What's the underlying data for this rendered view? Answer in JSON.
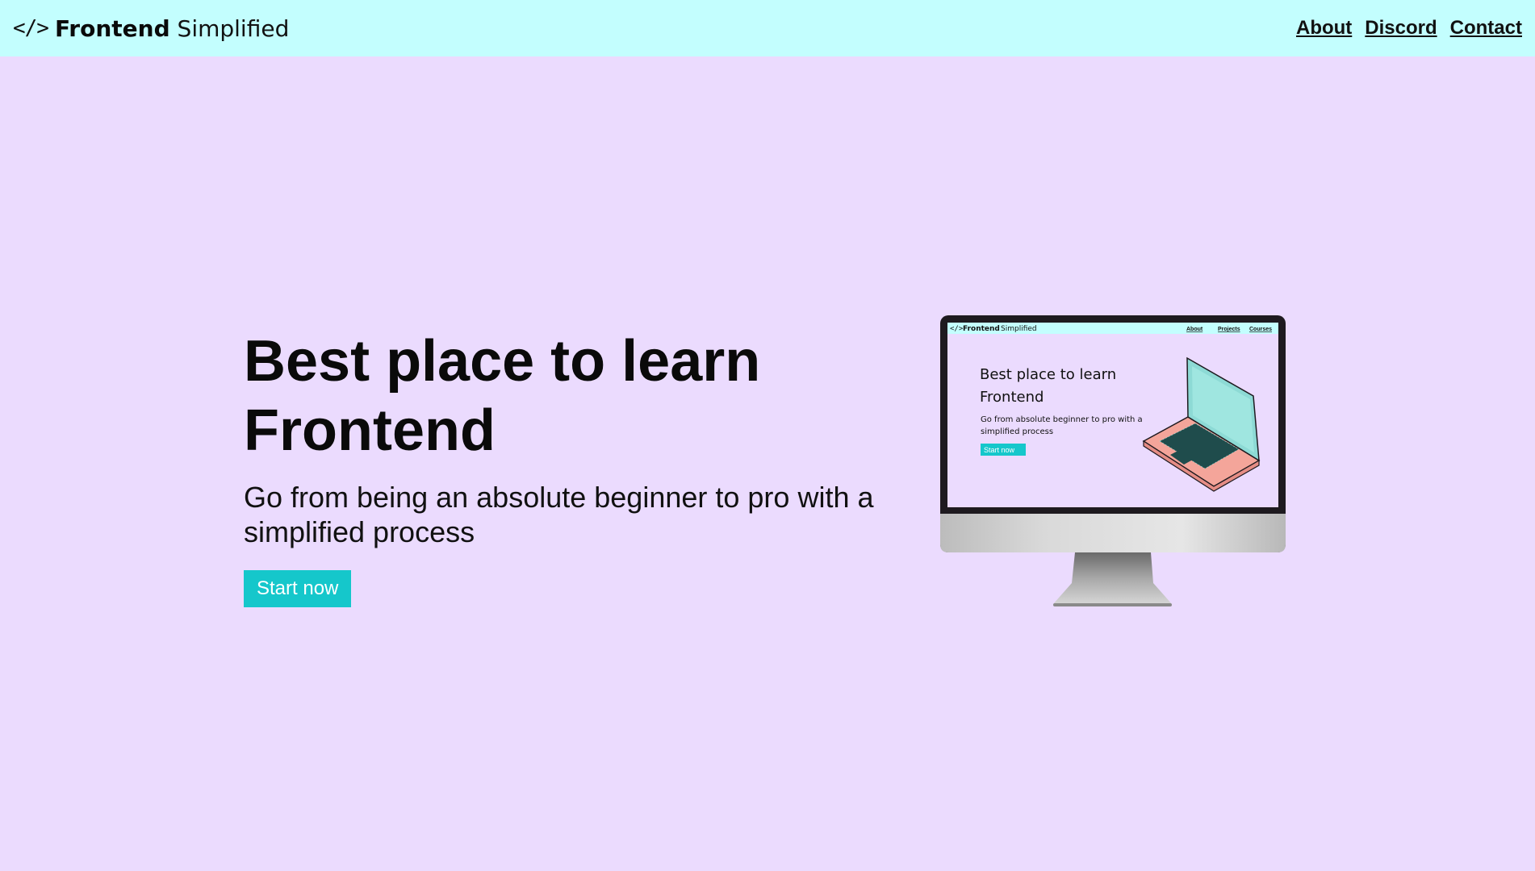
{
  "nav": {
    "logo_icon": "</>",
    "logo_bold": "Frontend",
    "logo_light": "Simplified",
    "links": [
      "About",
      "Discord",
      "Contact"
    ]
  },
  "hero": {
    "title_line1": "Best place to learn",
    "title_line2": "Frontend",
    "subtitle": "Go from being an absolute beginner to pro with a simplified process",
    "cta_label": "Start now"
  },
  "monitor_screen": {
    "logo_icon": "</>",
    "logo_bold": "Frontend",
    "logo_light": "Simplified",
    "links": [
      "About",
      "Projects",
      "Courses"
    ],
    "title_line1": "Best place to learn",
    "title_line2": "Frontend",
    "subtitle_line1": "Go from absolute beginner to pro with a",
    "subtitle_line2": "simplified process",
    "cta_label": "Start now"
  },
  "colors": {
    "page_background": "#ebdbfe",
    "navbar_background": "#c3fefe",
    "accent": "#15c7cb",
    "text": "#0a0a0a"
  }
}
